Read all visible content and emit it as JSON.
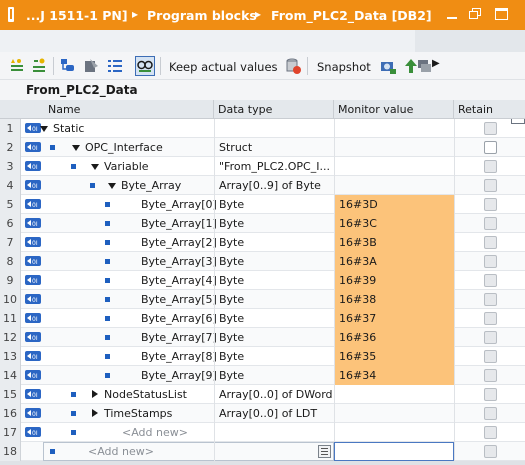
{
  "titlebar": {
    "crumbs": [
      "...J 1511-1 PN]",
      "Program blocks",
      "From_PLC2_Data [DB2]"
    ],
    "separator": "▸"
  },
  "toolbar": {
    "keep_actual_values": "Keep actual values",
    "snapshot": "Snapshot"
  },
  "block": {
    "title": "From_PLC2_Data"
  },
  "table": {
    "headers": {
      "name": "Name",
      "data_type": "Data type",
      "monitor_value": "Monitor value",
      "retain": "Retain"
    },
    "rows": [
      {
        "num": "1",
        "name": "Static",
        "type": "",
        "monitor": "",
        "expander": "expanded",
        "depth": 0
      },
      {
        "num": "2",
        "name": "OPC_Interface",
        "type": "Struct",
        "monitor": "",
        "expander": "expanded",
        "depth": 1
      },
      {
        "num": "3",
        "name": "Variable",
        "type": "\"From_PLC2.OPC_I...",
        "monitor": "",
        "expander": "expanded",
        "depth": 2
      },
      {
        "num": "4",
        "name": "Byte_Array",
        "type": "Array[0..9] of Byte",
        "monitor": "",
        "expander": "expanded",
        "depth": 3
      },
      {
        "num": "5",
        "name": "Byte_Array[0]",
        "type": "Byte",
        "monitor": "16#3D",
        "expander": "none",
        "depth": 4
      },
      {
        "num": "6",
        "name": "Byte_Array[1]",
        "type": "Byte",
        "monitor": "16#3C",
        "expander": "none",
        "depth": 4
      },
      {
        "num": "7",
        "name": "Byte_Array[2]",
        "type": "Byte",
        "monitor": "16#3B",
        "expander": "none",
        "depth": 4
      },
      {
        "num": "8",
        "name": "Byte_Array[3]",
        "type": "Byte",
        "monitor": "16#3A",
        "expander": "none",
        "depth": 4
      },
      {
        "num": "9",
        "name": "Byte_Array[4]",
        "type": "Byte",
        "monitor": "16#39",
        "expander": "none",
        "depth": 4
      },
      {
        "num": "10",
        "name": "Byte_Array[5]",
        "type": "Byte",
        "monitor": "16#38",
        "expander": "none",
        "depth": 4
      },
      {
        "num": "11",
        "name": "Byte_Array[6]",
        "type": "Byte",
        "monitor": "16#37",
        "expander": "none",
        "depth": 4
      },
      {
        "num": "12",
        "name": "Byte_Array[7]",
        "type": "Byte",
        "monitor": "16#36",
        "expander": "none",
        "depth": 4
      },
      {
        "num": "13",
        "name": "Byte_Array[8]",
        "type": "Byte",
        "monitor": "16#35",
        "expander": "none",
        "depth": 4
      },
      {
        "num": "14",
        "name": "Byte_Array[9]",
        "type": "Byte",
        "monitor": "16#34",
        "expander": "none",
        "depth": 4
      },
      {
        "num": "15",
        "name": "NodeStatusList",
        "type": "Array[0..0] of DWord",
        "monitor": "",
        "expander": "collapsed",
        "depth": 2
      },
      {
        "num": "16",
        "name": "TimeStamps",
        "type": "Array[0..0] of LDT",
        "monitor": "",
        "expander": "collapsed",
        "depth": 2
      },
      {
        "num": "17",
        "name": "<Add new>",
        "type": "",
        "monitor": "",
        "expander": "add",
        "depth": 2
      },
      {
        "num": "18",
        "name": "<Add new>",
        "type": "",
        "monitor": "",
        "expander": "add",
        "depth": 1
      }
    ]
  },
  "colors": {
    "title_bar": "#f08d13",
    "monitor_highlight": "#fcc37a",
    "member_icon": "#1e5fbf"
  }
}
